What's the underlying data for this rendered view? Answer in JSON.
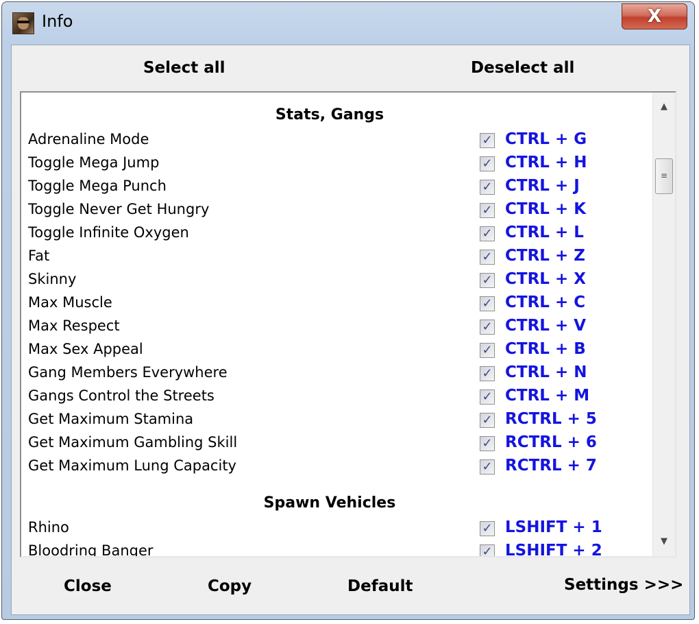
{
  "window": {
    "title": "Info",
    "close_glyph": "X"
  },
  "toolbar": {
    "select_all": "Select all",
    "deselect_all": "Deselect all"
  },
  "sections": [
    {
      "header": "Stats, Gangs",
      "items": [
        {
          "label": "Adrenaline Mode",
          "hotkey": "CTRL + G",
          "checked": true
        },
        {
          "label": "Toggle Mega Jump",
          "hotkey": "CTRL + H",
          "checked": true
        },
        {
          "label": "Toggle Mega Punch",
          "hotkey": "CTRL + J",
          "checked": true
        },
        {
          "label": "Toggle Never Get Hungry",
          "hotkey": "CTRL + K",
          "checked": true
        },
        {
          "label": "Toggle Infinite Oxygen",
          "hotkey": "CTRL + L",
          "checked": true
        },
        {
          "label": "Fat",
          "hotkey": "CTRL + Z",
          "checked": true
        },
        {
          "label": "Skinny",
          "hotkey": "CTRL + X",
          "checked": true
        },
        {
          "label": "Max Muscle",
          "hotkey": "CTRL + C",
          "checked": true
        },
        {
          "label": "Max Respect",
          "hotkey": "CTRL + V",
          "checked": true
        },
        {
          "label": "Max Sex Appeal",
          "hotkey": "CTRL + B",
          "checked": true
        },
        {
          "label": "Gang Members Everywhere",
          "hotkey": "CTRL + N",
          "checked": true
        },
        {
          "label": "Gangs Control the Streets",
          "hotkey": "CTRL + M",
          "checked": true
        },
        {
          "label": "Get Maximum Stamina",
          "hotkey": "RCTRL + 5",
          "checked": true
        },
        {
          "label": "Get Maximum Gambling Skill",
          "hotkey": "RCTRL + 6",
          "checked": true
        },
        {
          "label": "Get Maximum Lung Capacity",
          "hotkey": "RCTRL + 7",
          "checked": true
        }
      ]
    },
    {
      "header": "Spawn Vehicles",
      "items": [
        {
          "label": "Rhino",
          "hotkey": "LSHIFT + 1",
          "checked": true
        },
        {
          "label": "Bloodring Banger",
          "hotkey": "LSHIFT + 2",
          "checked": true
        }
      ]
    }
  ],
  "icons": {
    "check": "✓",
    "scroll_up": "▲",
    "scroll_down": "▼",
    "thumb_grip": "≡"
  },
  "footer": {
    "close": "Close",
    "copy": "Copy",
    "default": "Default",
    "settings": "Settings >>>"
  },
  "colors": {
    "hotkey": "#1414e0",
    "title_close_button": "#c0412e",
    "client_background": "#efefef"
  }
}
